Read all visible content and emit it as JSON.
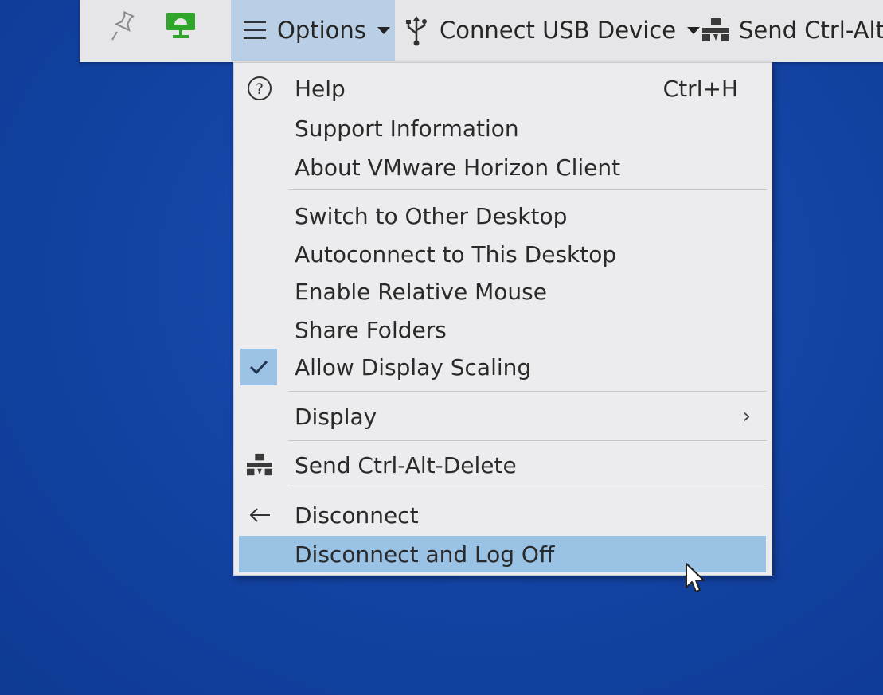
{
  "toolbar": {
    "pin_icon": "pin-icon",
    "monitor_icon": "monitor-icon",
    "options_label": "Options",
    "usb_label": "Connect USB Device",
    "cad_label": "Send Ctrl-Alt-"
  },
  "menu": {
    "help_label": "Help",
    "help_shortcut": "Ctrl+H",
    "support_label": "Support Information",
    "about_label": "About VMware Horizon Client",
    "switch_label": "Switch to Other Desktop",
    "autoconnect_label": "Autoconnect to This Desktop",
    "relative_mouse_label": "Enable Relative Mouse",
    "share_folders_label": "Share Folders",
    "display_scaling_label": "Allow Display Scaling",
    "display_scaling_checked": true,
    "display_label": "Display",
    "send_cad_label": "Send Ctrl-Alt-Delete",
    "disconnect_label": "Disconnect",
    "disconnect_logoff_label": "Disconnect and Log Off"
  },
  "colors": {
    "desktop": "#1444a6",
    "toolbar": "#e6e6e8",
    "options_active": "#b9cfe6",
    "menu_bg": "#ececee",
    "highlight": "#99c2e5",
    "monitor_green": "#2fa62a"
  }
}
